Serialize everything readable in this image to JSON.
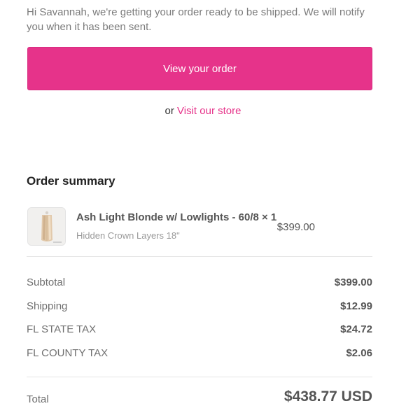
{
  "email": {
    "intro_text": "Hi Savannah, we're getting your order ready to be shipped. We will notify you when it has been sent.",
    "view_order_label": "View your order",
    "or_text": "or",
    "visit_store_label": "Visit our store"
  },
  "summary": {
    "title": "Order summary",
    "item": {
      "name": "Ash Light Blonde w/ Lowlights - 60/8 × 1",
      "variant": "Hidden Crown Layers 18\"",
      "price": "$399.00"
    },
    "lines": [
      {
        "label": "Subtotal",
        "value": "$399.00"
      },
      {
        "label": "Shipping",
        "value": "$12.99"
      },
      {
        "label": "FL STATE TAX",
        "value": "$24.72"
      },
      {
        "label": "FL COUNTY TAX",
        "value": "$2.06"
      }
    ],
    "total_label": "Total",
    "total_value": "$438.77 USD"
  },
  "colors": {
    "accent": "#e6338a",
    "text_muted": "#7b7b7b",
    "divider": "#e5e5e5"
  }
}
